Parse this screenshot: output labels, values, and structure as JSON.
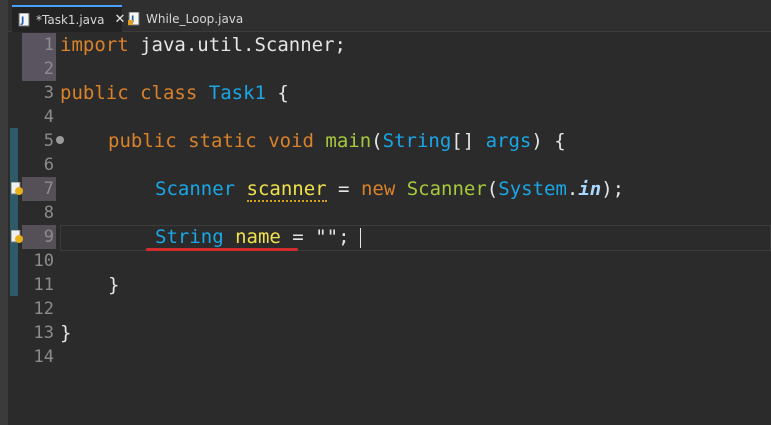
{
  "tabs": [
    {
      "label": "*Task1.java",
      "active": true,
      "close": "✕"
    },
    {
      "label": "While_Loop.java",
      "active": false
    }
  ],
  "gutter": [
    "1",
    "2",
    "3",
    "4",
    "5",
    "6",
    "7",
    "8",
    "9",
    "10",
    "11",
    "12",
    "13",
    "14"
  ],
  "code": {
    "l1_kw": "import",
    "l1_rest": " java.util.Scanner;",
    "l3_kw1": "public",
    "l3_kw2": "class",
    "l3_cls": "Task1",
    "l3_brace": " {",
    "l5_kw1": "public",
    "l5_kw2": "static",
    "l5_kw3": "void",
    "l5_method": "main",
    "l5_open": "(",
    "l5_type": "String",
    "l5_brackets": "[]",
    "l5_arg": "args",
    "l5_close": ") {",
    "l7_type": "Scanner",
    "l7_var": "scanner",
    "l7_eq": " = ",
    "l7_new": "new",
    "l7_ctor": "Scanner",
    "l7_open": "(",
    "l7_sys": "System",
    "l7_dot": ".",
    "l7_in": "in",
    "l7_end": ");",
    "l9_type": "String",
    "l9_var": "name",
    "l9_eq": " = ",
    "l9_str": "\"\"",
    "l9_semi": ";",
    "l11_brace": "}",
    "l13_brace": "}"
  },
  "colors": {
    "keyword": "#d9822b",
    "type": "#1aa7e6",
    "method": "#a7c93d",
    "variable": "#f0e24d",
    "error_underline": "#d22c2c"
  },
  "icons": {
    "tab_file": "java-file-icon",
    "warning": "warning-lightbulb-icon",
    "fold": "fold-collapse-icon"
  }
}
